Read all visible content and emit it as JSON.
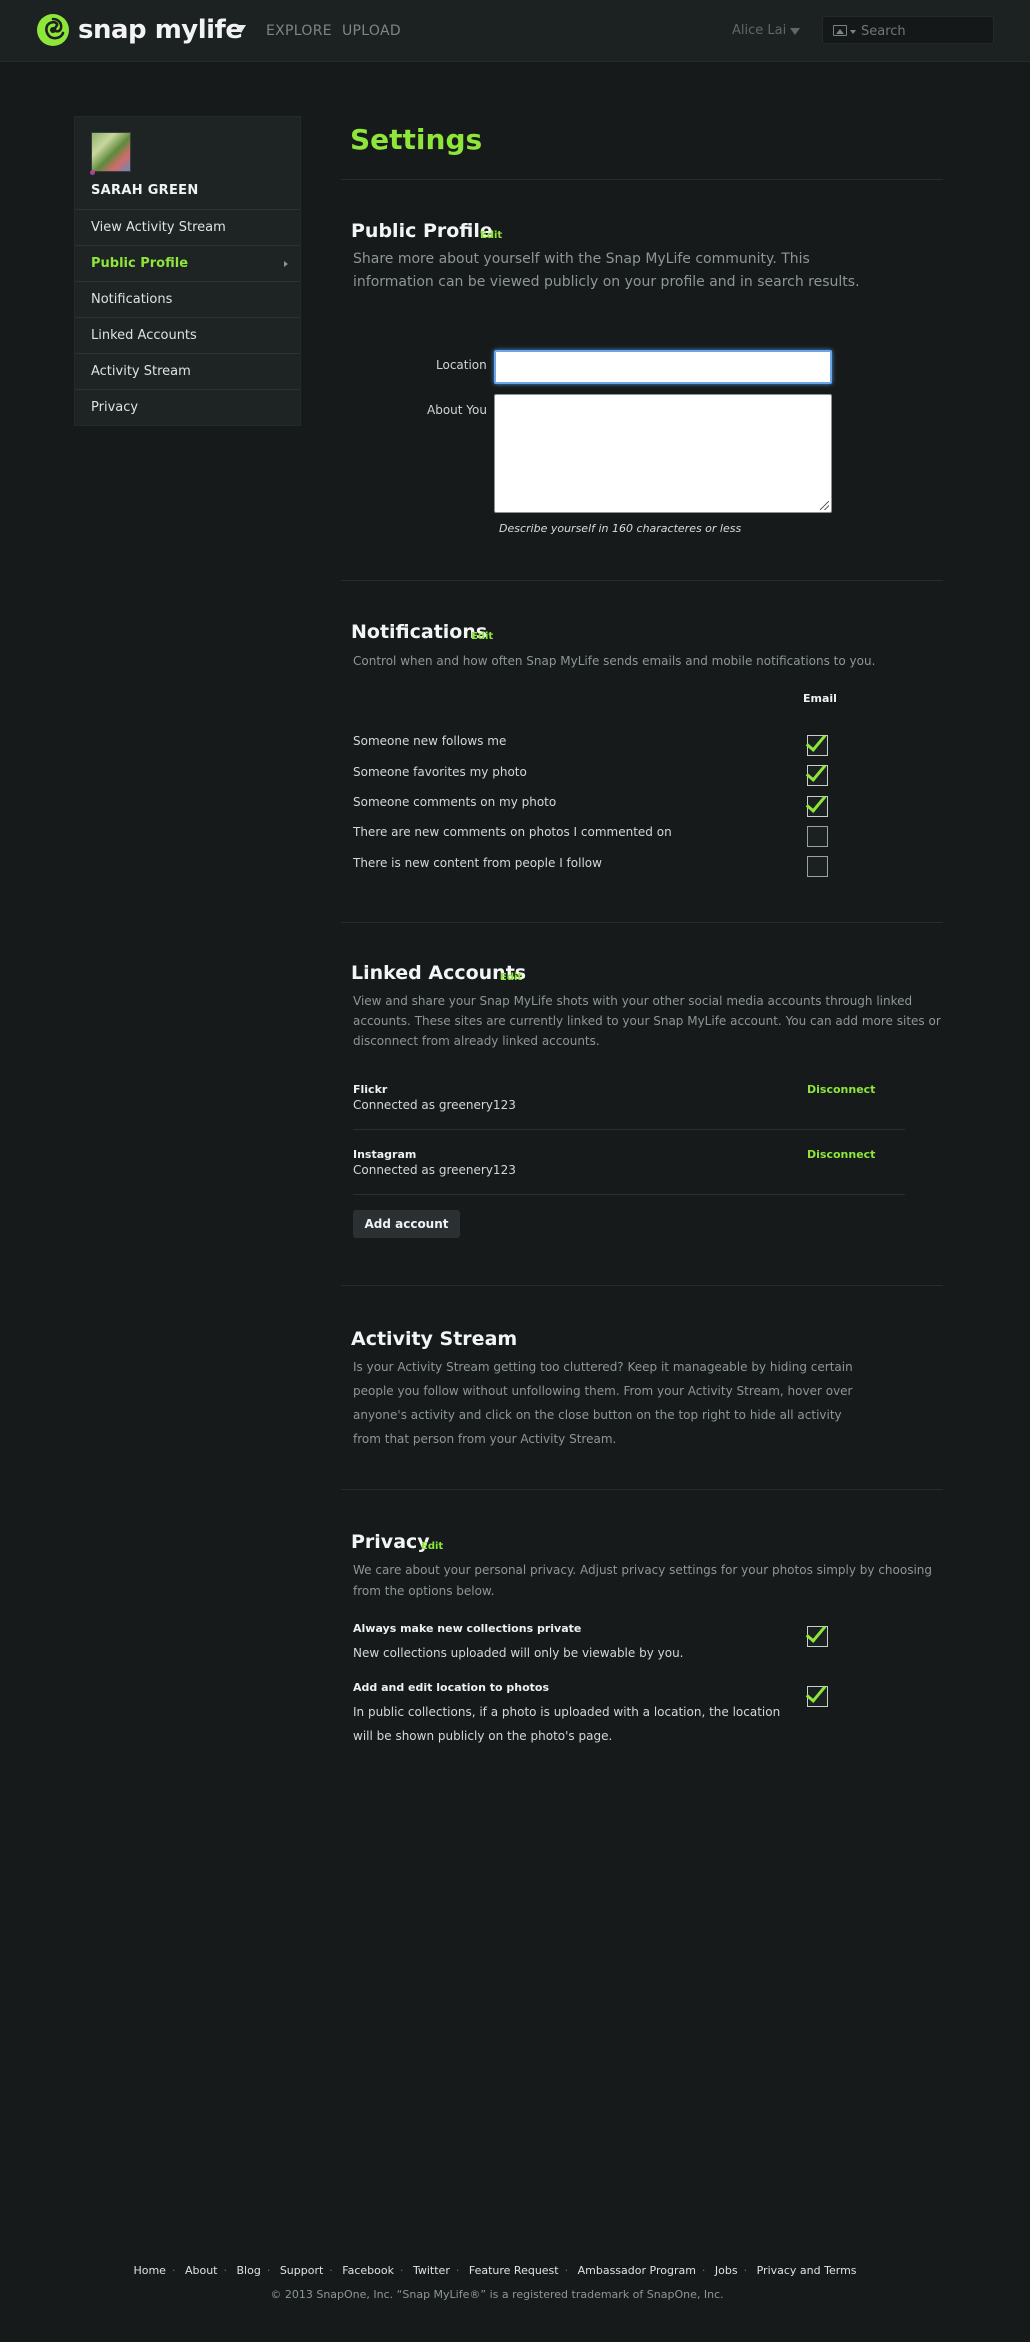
{
  "header": {
    "logo_text": "snap mylife",
    "nav": [
      "EXPLORE",
      "UPLOAD"
    ],
    "user_name": "Alice Lai",
    "search_placeholder": "Search"
  },
  "sidebar": {
    "user_name": "SARAH GREEN",
    "items": [
      {
        "label": "View Activity Stream"
      },
      {
        "label": "Public Profile"
      },
      {
        "label": "Notifications"
      },
      {
        "label": "Linked Accounts"
      },
      {
        "label": "Activity Stream"
      },
      {
        "label": "Privacy"
      }
    ]
  },
  "main": {
    "title": "Settings",
    "public_profile": {
      "title": "Public Profile",
      "edit": "Edit",
      "desc_line1": "Share more about yourself with the Snap MyLife community. This",
      "desc_line2": "information can be viewed publicly on your profile and in search results.",
      "location_label": "Location",
      "location_value": "",
      "about_label": "About You",
      "about_value": "",
      "hint": "Describe yourself in 160 characteres or less"
    },
    "notifications": {
      "title": "Notifications",
      "edit": "Edit",
      "desc": "Control when and how often Snap MyLife sends emails and mobile notifications to you.",
      "email_header": "Email",
      "rows": [
        {
          "label": "Someone new follows me",
          "checked": true
        },
        {
          "label": "Someone favorites my photo",
          "checked": true
        },
        {
          "label": "Someone comments on my photo",
          "checked": true
        },
        {
          "label": "There are new comments on photos I commented on",
          "checked": false
        },
        {
          "label": "There is new content from people I follow",
          "checked": false
        }
      ]
    },
    "linked_accounts": {
      "title": "Linked Accounts",
      "edit": "Edit",
      "desc_line1": "View and share your Snap MyLife shots with your other social media accounts through linked",
      "desc_line2": "accounts. These sites are currently linked to your Snap MyLife account. You can add more sites or",
      "desc_line3": "disconnect from already linked accounts.",
      "accounts": [
        {
          "name": "Flickr",
          "status": "Connected as greenery123",
          "action": "Disconnect"
        },
        {
          "name": "Instagram",
          "status": "Connected as greenery123",
          "action": "Disconnect"
        }
      ],
      "add_button": "Add account"
    },
    "activity_stream": {
      "title": "Activity Stream",
      "desc_line1": "Is your Activity Stream getting too cluttered? Keep it manageable by hiding certain",
      "desc_line2": "people you follow without unfollowing them. From your Activity Stream, hover over",
      "desc_line3": "anyone's activity and click on the close button on the top right to hide all activity",
      "desc_line4": "from that person from your Activity Stream."
    },
    "privacy": {
      "title": "Privacy",
      "edit": "Edit",
      "desc_line1": "We care about your personal privacy. Adjust privacy settings for your photos simply by choosing",
      "desc_line2": "from the options below.",
      "options": [
        {
          "title": "Always make new collections private",
          "line1": "New collections uploaded will only be viewable by you.",
          "line2": "",
          "checked": true
        },
        {
          "title": "Add and edit location to photos",
          "line1": "In public collections, if a photo is uploaded with a location, the location",
          "line2": "will be shown publicly on the photo's page.",
          "checked": true
        }
      ]
    }
  },
  "footer": {
    "links": [
      "Home",
      "About",
      "Blog",
      "Support",
      "Facebook",
      "Twitter",
      "Feature Request",
      "Ambassador Program",
      "Jobs",
      "Privacy and Terms"
    ],
    "copyright": "© 2013 SnapOne, Inc. “Snap MyLife®” is a registered trademark of SnapOne, Inc."
  },
  "colors": {
    "accent": "#8ee63a",
    "background": "#161a1b",
    "header": "#1c2122"
  }
}
